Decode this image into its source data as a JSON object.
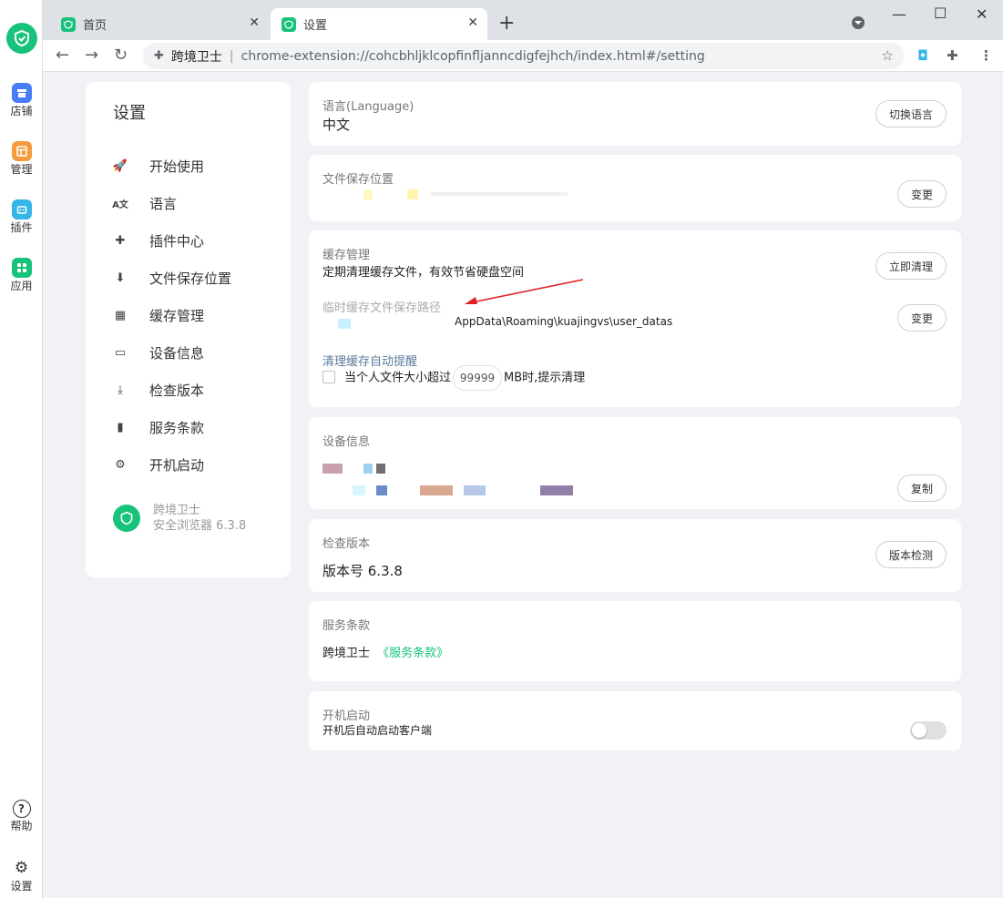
{
  "rail": {
    "items": [
      {
        "label": "店铺",
        "color": "#4a7cf7"
      },
      {
        "label": "管理",
        "color": "#f59b3c"
      },
      {
        "label": "插件",
        "color": "#36b5e8"
      },
      {
        "label": "应用",
        "color": "#17c27b"
      }
    ],
    "help": "帮助",
    "settings": "设置"
  },
  "tabs": {
    "inactive": "首页",
    "active": "设置"
  },
  "omnibox": {
    "site": "跨境卫士",
    "url": "chrome-extension://cohcbhljklcopfinfljanncdigfejhch/index.html#/setting"
  },
  "nav": {
    "title": "设置",
    "items": [
      {
        "label": "开始使用",
        "icon": "rocket-icon"
      },
      {
        "label": "语言",
        "icon": "translate-icon"
      },
      {
        "label": "插件中心",
        "icon": "puzzle-icon"
      },
      {
        "label": "文件保存位置",
        "icon": "download-circle-icon"
      },
      {
        "label": "缓存管理",
        "icon": "calendar-icon"
      },
      {
        "label": "设备信息",
        "icon": "monitor-icon"
      },
      {
        "label": "检查版本",
        "icon": "download-tray-icon"
      },
      {
        "label": "服务条款",
        "icon": "file-icon"
      },
      {
        "label": "开机启动",
        "icon": "gear-icon"
      }
    ],
    "brand_name": "跨境卫士",
    "brand_version": "安全浏览器 6.3.8"
  },
  "language": {
    "title": "语言(Language)",
    "value": "中文",
    "button": "切换语言"
  },
  "save_location": {
    "title": "文件保存位置",
    "button": "变更"
  },
  "cache": {
    "title": "缓存管理",
    "desc": "定期清理缓存文件，有效节省硬盘空间",
    "clear_button": "立即清理",
    "temp_path_title": "临时缓存文件保存路径",
    "temp_path_value": "AppData\\Roaming\\kuajingvs\\user_datas",
    "change_button": "变更",
    "auto_title": "清理缓存自动提醒",
    "auto_prefix": "当个人文件大小超过",
    "auto_value": "99999",
    "auto_suffix": "MB时,提示清理"
  },
  "device": {
    "title": "设备信息",
    "button": "复制"
  },
  "version": {
    "title": "检查版本",
    "value": "版本号 6.3.8",
    "button": "版本检测"
  },
  "terms": {
    "title": "服务条款",
    "prefix": "跨境卫士",
    "link": "《服务条款》"
  },
  "startup": {
    "title": "开机启动",
    "desc": "开机后自动启动客户端",
    "enabled": false
  },
  "colors": {
    "brand": "#17c27b",
    "link": "#17c27b",
    "arrow": "#e02020"
  }
}
